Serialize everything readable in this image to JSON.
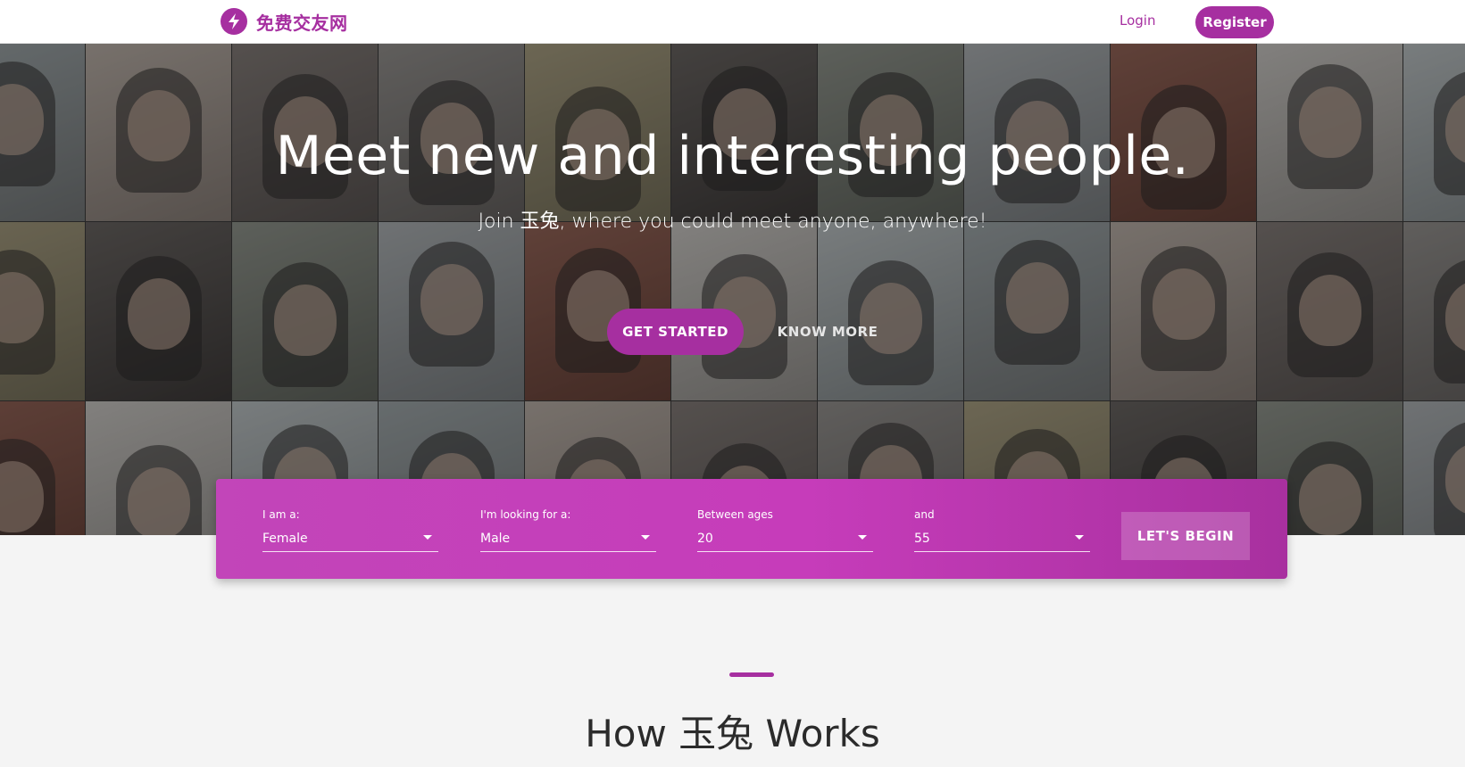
{
  "nav": {
    "brand_name": "免费交友网",
    "login_label": "Login",
    "register_label": "Register",
    "accent_color": "#a62fa0",
    "logo_icon": "lightning-bolt-icon"
  },
  "hero": {
    "title": "Meet new and interesting people.",
    "subtitle": "Join 玉兔, where you could meet anyone, anywhere!",
    "get_started_label": "GET STARTED",
    "know_more_label": "KNOW MORE"
  },
  "search": {
    "i_am_label": "I am a:",
    "i_am_value": "Female",
    "looking_for_label": "I'm looking for a:",
    "looking_for_value": "Male",
    "age_min_label": "Between ages",
    "age_min_value": "20",
    "age_max_label": "and",
    "age_max_value": "55",
    "begin_label": "LET'S BEGIN"
  },
  "how_it_works": {
    "title": "How 玉兔 Works"
  }
}
